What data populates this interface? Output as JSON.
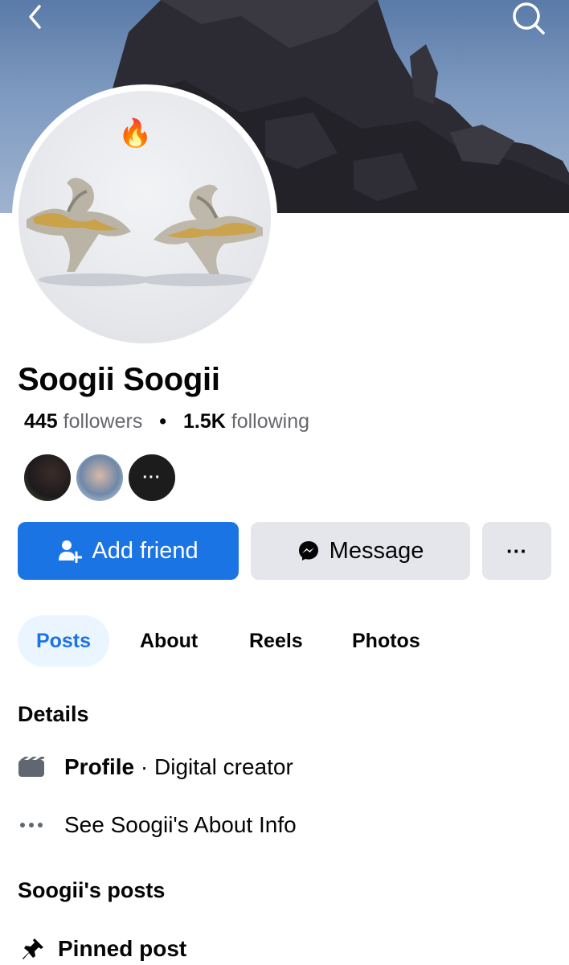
{
  "profile": {
    "name": "Soogii Soogii",
    "avatar_badge": "🔥"
  },
  "stats": {
    "followers_count": "445",
    "followers_label": "followers",
    "separator": "•",
    "following_count": "1.5K",
    "following_label": "following"
  },
  "mutual_friends": {
    "more_label": "···"
  },
  "actions": {
    "add_friend": "Add friend",
    "message": "Message",
    "more": "···"
  },
  "tabs": {
    "posts": "Posts",
    "about": "About",
    "reels": "Reels",
    "photos": "Photos",
    "active": "Posts"
  },
  "details": {
    "title": "Details",
    "profile_label": "Profile",
    "profile_sep": " · ",
    "profile_category": "Digital creator",
    "about_link": "See Soogii's About Info"
  },
  "posts_section": {
    "title": "Soogii's posts",
    "pinned_label": "Pinned post"
  },
  "icons": {
    "back": "chevron-left-icon",
    "search": "search-icon",
    "add_friend": "add-friend-icon",
    "messenger": "messenger-icon",
    "profile": "clapperboard-icon",
    "more": "more-dots-icon",
    "pin": "pin-icon"
  },
  "colors": {
    "accent": "#1b74e4",
    "secondary_button": "#e4e6eb",
    "active_tab_bg": "#ebf5ff",
    "muted_text": "#65676b"
  }
}
